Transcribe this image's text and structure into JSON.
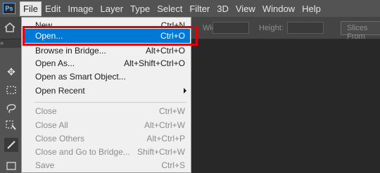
{
  "app": {
    "logo": "Ps"
  },
  "menubar": {
    "items": [
      "File",
      "Edit",
      "Image",
      "Layer",
      "Type",
      "Select",
      "Filter",
      "3D",
      "View",
      "Window",
      "Help"
    ]
  },
  "options_bar": {
    "width_label": "Width:",
    "height_label": "Height:",
    "slices_button": "Slices From"
  },
  "file_menu": {
    "items": [
      {
        "label": "New...",
        "shortcut": "Ctrl+N",
        "state": "enabled"
      },
      {
        "label": "Open...",
        "shortcut": "Ctrl+O",
        "state": "highlighted"
      },
      {
        "label": "Browse in Bridge...",
        "shortcut": "Alt+Ctrl+O",
        "state": "enabled"
      },
      {
        "label": "Open As...",
        "shortcut": "Alt+Shift+Ctrl+O",
        "state": "enabled"
      },
      {
        "label": "Open as Smart Object...",
        "shortcut": "",
        "state": "enabled"
      },
      {
        "label": "Open Recent",
        "shortcut": "",
        "state": "submenu"
      },
      {
        "label": "Close",
        "shortcut": "Ctrl+W",
        "state": "disabled"
      },
      {
        "label": "Close All",
        "shortcut": "Alt+Ctrl+W",
        "state": "disabled"
      },
      {
        "label": "Close Others",
        "shortcut": "Alt+Ctrl+P",
        "state": "disabled"
      },
      {
        "label": "Close and Go to Bridge...",
        "shortcut": "Shift+Ctrl+W",
        "state": "disabled"
      },
      {
        "label": "Save",
        "shortcut": "Ctrl+S",
        "state": "disabled"
      }
    ]
  },
  "colors": {
    "highlight": "#0078d7",
    "annotation": "#e1000a",
    "menubar": "#535353",
    "canvas": "#282828"
  },
  "icons": [
    "home-icon",
    "move-tool-icon",
    "marquee-tool-icon",
    "lasso-tool-icon",
    "quick-select-tool-icon",
    "crop-tool-icon"
  ]
}
